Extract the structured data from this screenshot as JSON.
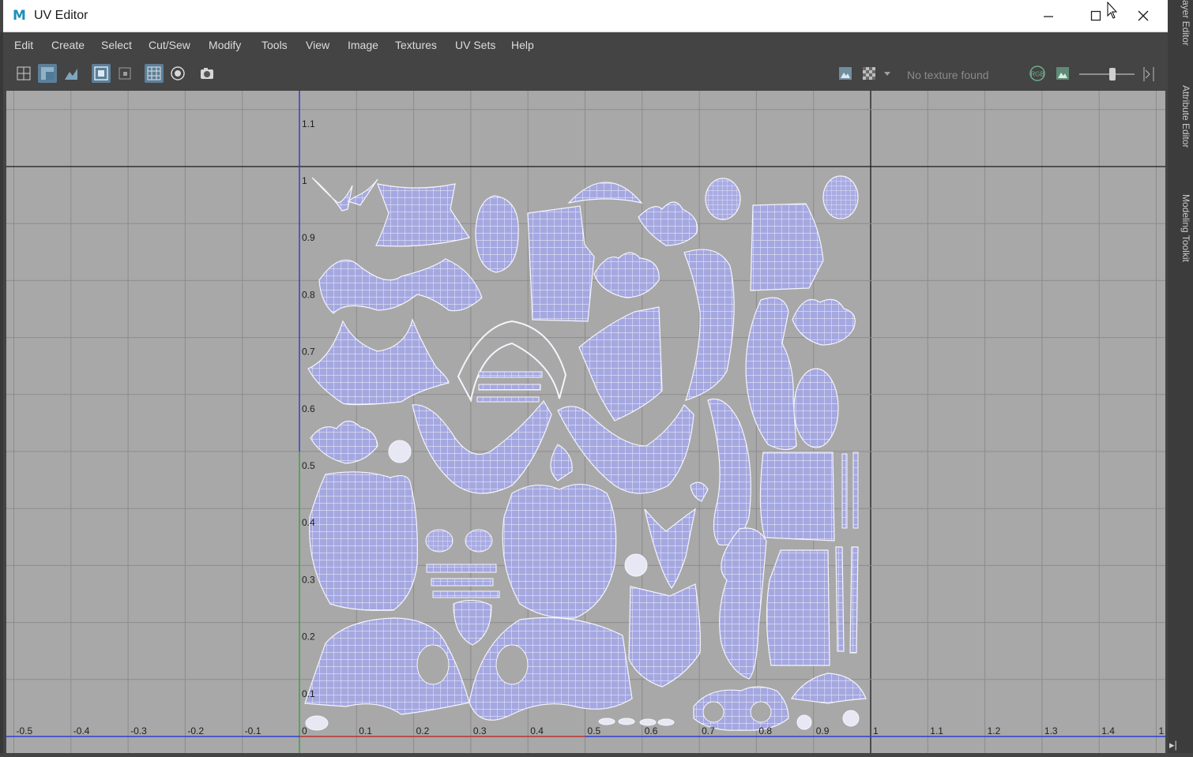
{
  "window": {
    "title": "UV Editor",
    "logo_letter": "M",
    "controls": [
      "minimize-icon",
      "maximize-icon",
      "close-icon"
    ]
  },
  "menu": [
    "Edit",
    "Create",
    "Select",
    "Cut/Sew",
    "Modify",
    "Tools",
    "View",
    "Image",
    "Textures",
    "UV Sets",
    "Help"
  ],
  "toolbar": {
    "left_icons": [
      "uv-grid-icon",
      "shaded-uv-icon",
      "texture-borders-icon",
      "dim-image-icon",
      "image-region-icon",
      "grid-toggle-icon",
      "pixel-snap-icon",
      "snapshot-icon"
    ],
    "right_icons": [
      "display-image-icon",
      "checker-icon",
      "dropdown-arrow-icon"
    ],
    "texture_status": "No texture found",
    "channel_label": "RGB",
    "exposure_slider": 0.6
  },
  "viewport": {
    "u_axis_labels": [
      "-0.5",
      "-0.4",
      "-0.3",
      "-0.2",
      "-0.1",
      "0",
      "0.1",
      "0.2",
      "0.3",
      "0.4",
      "0.5",
      "0.6",
      "0.7",
      "0.8",
      "0.9",
      "1",
      "1.1",
      "1.2",
      "1.3",
      "1.4",
      "1"
    ],
    "v_axis_labels": [
      "1.1",
      "1",
      "0.9",
      "0.8",
      "0.7",
      "0.6",
      "0.5",
      "0.4",
      "0.3",
      "0.2",
      "0.1"
    ],
    "colors": {
      "background": "#a8a8a8",
      "grid": "#8c8c8c",
      "major_line": "#1a1a1a",
      "v_axis": "#2d3fd6",
      "u_axis": "#2d3fd6",
      "uv_shell_fill": "#a5a8e0",
      "uv_shell_wire": "#ffffff"
    }
  },
  "dock_tabs": [
    "Attribute Editor",
    "Modeling Toolkit",
    "ayer Editor"
  ]
}
